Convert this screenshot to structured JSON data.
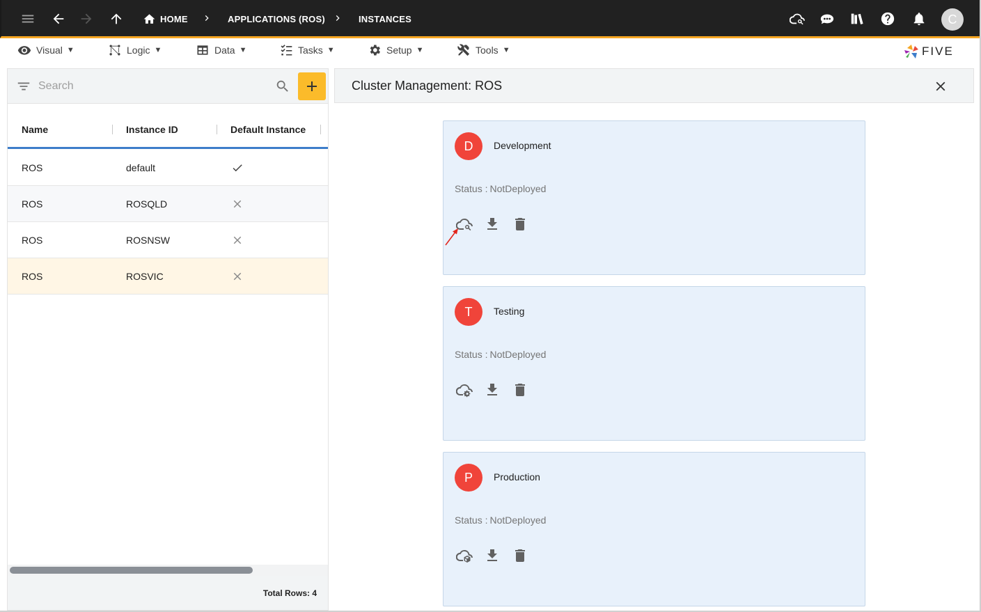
{
  "topbar": {
    "breadcrumbs": {
      "home": "HOME",
      "applications": "APPLICATIONS (ROS)",
      "instances": "INSTANCES"
    },
    "avatar_initial": "C",
    "icons": [
      "menu-icon",
      "back-arrow-icon",
      "forward-arrow-icon",
      "up-arrow-icon",
      "cloud-search-icon",
      "chat-bot-icon",
      "library-icon",
      "help-icon",
      "bell-icon"
    ]
  },
  "menubar": {
    "items": [
      {
        "label": "Visual",
        "icon": "eye-icon"
      },
      {
        "label": "Logic",
        "icon": "logic-icon"
      },
      {
        "label": "Data",
        "icon": "table-icon"
      },
      {
        "label": "Tasks",
        "icon": "tasks-icon"
      },
      {
        "label": "Setup",
        "icon": "gear-icon"
      },
      {
        "label": "Tools",
        "icon": "tools-icon"
      }
    ],
    "caret": "▼",
    "logo_text": "FIVE"
  },
  "list": {
    "search_placeholder": "Search",
    "columns": [
      "Name",
      "Instance ID",
      "Default Instance"
    ],
    "rows": [
      {
        "name": "ROS",
        "instance_id": "default",
        "default": true
      },
      {
        "name": "ROS",
        "instance_id": "ROSQLD",
        "default": false
      },
      {
        "name": "ROS",
        "instance_id": "ROSNSW",
        "default": false
      },
      {
        "name": "ROS",
        "instance_id": "ROSVIC",
        "default": false
      }
    ],
    "total_rows": "Total Rows: 4"
  },
  "detail": {
    "title": "Cluster Management: ROS",
    "cards": [
      {
        "initial": "D",
        "name": "Development",
        "status_label": "Status :",
        "status_value": "NotDeployed",
        "deploy_icon": "cloud-search-icon"
      },
      {
        "initial": "T",
        "name": "Testing",
        "status_label": "Status :",
        "status_value": "NotDeployed",
        "deploy_icon": "cloud-gear-icon"
      },
      {
        "initial": "P",
        "name": "Production",
        "status_label": "Status :",
        "status_value": "NotDeployed",
        "deploy_icon": "cloud-box-icon"
      }
    ]
  },
  "colors": {
    "topbar_bg": "#212121",
    "accent_orange": "#f5a623",
    "add_button": "#fbbb2a",
    "header_underline": "#3d7dca",
    "avatar_red": "#f0443a",
    "card_bg": "#e8f1fb",
    "selected_row": "#fff6e5"
  }
}
